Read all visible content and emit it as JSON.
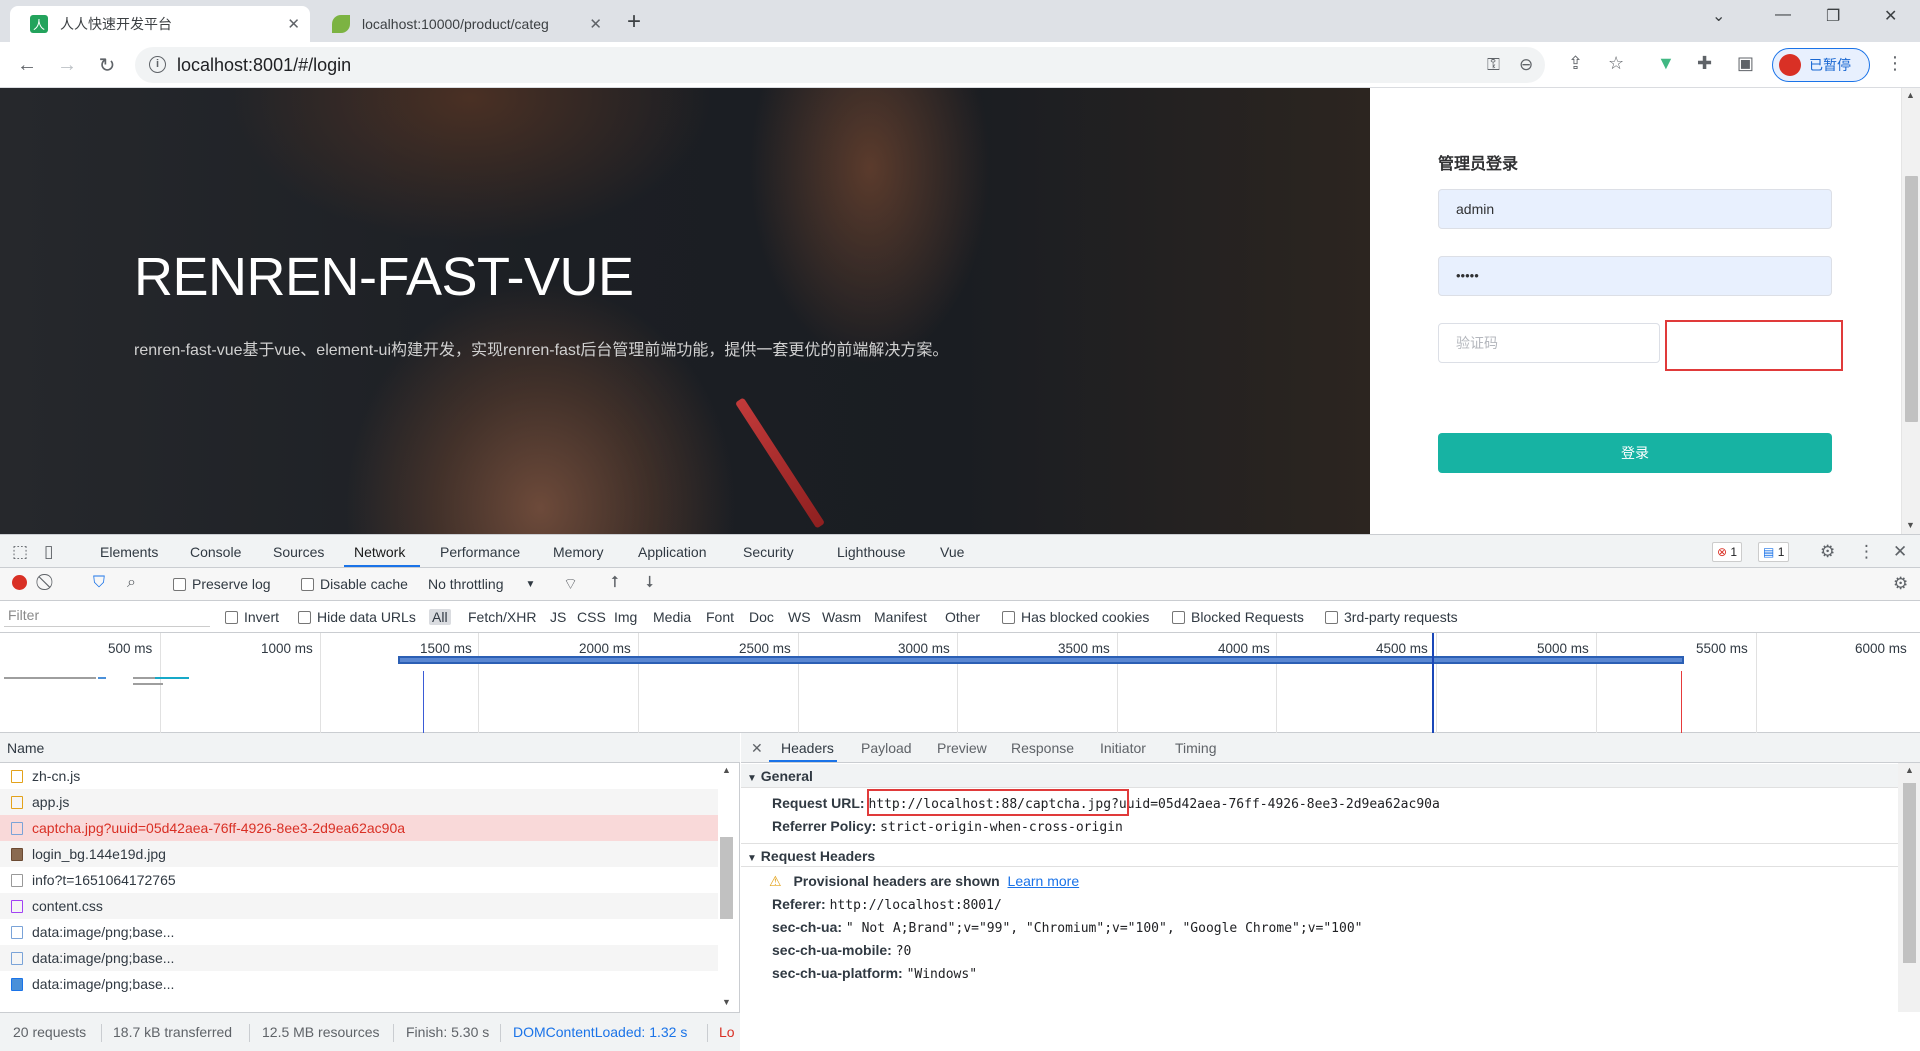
{
  "browser": {
    "tabs": [
      {
        "title": "人人快速开发平台",
        "favicon": "renren-icon"
      },
      {
        "title": "localhost:10000/product/categ",
        "favicon": "leaf-icon"
      }
    ],
    "new_tab": "+",
    "address": "localhost:8001/#/login",
    "profile_label": "已暂停"
  },
  "page": {
    "hero_title": "RENREN-FAST-VUE",
    "hero_desc": "renren-fast-vue基于vue、element-ui构建开发，实现renren-fast后台管理前端功能，提供一套更优的前端解决方案。",
    "login_title": "管理员登录",
    "username_value": "admin",
    "password_value": "•••••",
    "captcha_placeholder": "验证码",
    "login_button": "登录"
  },
  "devtools": {
    "tabs": [
      "Elements",
      "Console",
      "Sources",
      "Network",
      "Performance",
      "Memory",
      "Application",
      "Security",
      "Lighthouse",
      "Vue"
    ],
    "active_tab": "Network",
    "error_count": "1",
    "message_count": "1",
    "network_toolbar": {
      "preserve_log": "Preserve log",
      "disable_cache": "Disable cache",
      "throttling": "No throttling"
    },
    "filter": {
      "placeholder": "Filter",
      "invert": "Invert",
      "hide_data_urls": "Hide data URLs",
      "types": [
        "All",
        "Fetch/XHR",
        "JS",
        "CSS",
        "Img",
        "Media",
        "Font",
        "Doc",
        "WS",
        "Wasm",
        "Manifest",
        "Other"
      ],
      "has_blocked_cookies": "Has blocked cookies",
      "blocked_requests": "Blocked Requests",
      "third_party": "3rd-party requests"
    },
    "timeline_ticks": [
      "500 ms",
      "1000 ms",
      "1500 ms",
      "2000 ms",
      "2500 ms",
      "3000 ms",
      "3500 ms",
      "4000 ms",
      "4500 ms",
      "5000 ms",
      "5500 ms",
      "6000 ms"
    ],
    "requests_header": "Name",
    "requests": [
      {
        "name": "zh-cn.js",
        "icon": "script-icon"
      },
      {
        "name": "app.js",
        "icon": "script-icon"
      },
      {
        "name": "captcha.jpg?uuid=05d42aea-76ff-4926-8ee3-2d9ea62ac90a",
        "icon": "image-icon"
      },
      {
        "name": "login_bg.144e19d.jpg",
        "icon": "image-icon"
      },
      {
        "name": "info?t=1651064172765",
        "icon": "document-icon"
      },
      {
        "name": "content.css",
        "icon": "stylesheet-icon"
      },
      {
        "name": "data:image/png;base...",
        "icon": "image-icon"
      },
      {
        "name": "data:image/png;base...",
        "icon": "image-icon"
      },
      {
        "name": "data:image/png;base...",
        "icon": "image-icon"
      }
    ],
    "detail_tabs": [
      "Headers",
      "Payload",
      "Preview",
      "Response",
      "Initiator",
      "Timing"
    ],
    "general": {
      "title": "General",
      "request_url_key": "Request URL:",
      "request_url_value": "http://localhost:88/captcha.jpg?uuid=05d42aea-76ff-4926-8ee3-2d9ea62ac90a",
      "referrer_policy_key": "Referrer Policy:",
      "referrer_policy_value": "strict-origin-when-cross-origin"
    },
    "request_headers": {
      "title": "Request Headers",
      "warning": "Provisional headers are shown",
      "learn_more": "Learn more",
      "rows": [
        {
          "k": "Referer:",
          "v": "http://localhost:8001/"
        },
        {
          "k": "sec-ch-ua:",
          "v": "\" Not A;Brand\";v=\"99\", \"Chromium\";v=\"100\", \"Google Chrome\";v=\"100\""
        },
        {
          "k": "sec-ch-ua-mobile:",
          "v": "?0"
        },
        {
          "k": "sec-ch-ua-platform:",
          "v": "\"Windows\""
        }
      ]
    },
    "status": {
      "requests": "20 requests",
      "transferred": "18.7 kB transferred",
      "resources": "12.5 MB resources",
      "finish": "Finish: 5.30 s",
      "dcl": "DOMContentLoaded: 1.32 s",
      "load": "Lo"
    }
  }
}
